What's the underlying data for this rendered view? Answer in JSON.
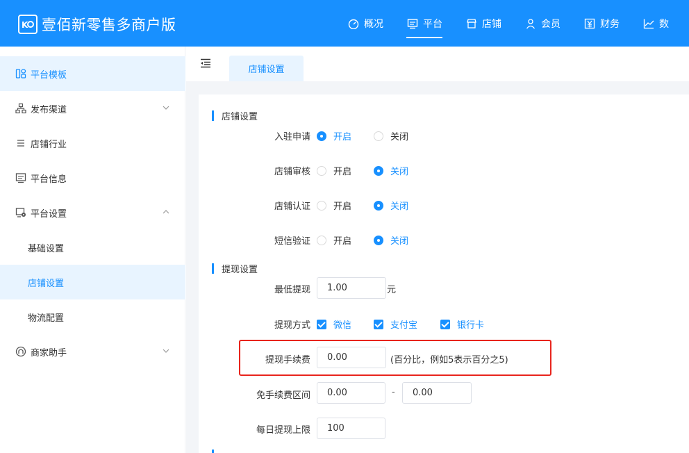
{
  "header": {
    "title": "壹佰新零售多商户版",
    "nav": [
      {
        "label": "概况",
        "icon": "dashboard-icon"
      },
      {
        "label": "平台",
        "icon": "monitor-icon"
      },
      {
        "label": "店铺",
        "icon": "shop-icon"
      },
      {
        "label": "会员",
        "icon": "user-icon"
      },
      {
        "label": "财务",
        "icon": "finance-icon"
      },
      {
        "label": "数",
        "icon": "chart-line-icon"
      }
    ]
  },
  "sidebar": {
    "items": [
      {
        "label": "平台模板"
      },
      {
        "label": "发布渠道"
      },
      {
        "label": "店铺行业"
      },
      {
        "label": "平台信息"
      },
      {
        "label": "平台设置"
      },
      {
        "label": "基础设置"
      },
      {
        "label": "店铺设置"
      },
      {
        "label": "物流配置"
      },
      {
        "label": "商家助手"
      }
    ]
  },
  "tab": {
    "label": "店铺设置"
  },
  "store_settings": {
    "title": "店铺设置",
    "rows": [
      {
        "label": "入驻申请",
        "on": "开启",
        "off": "关闭"
      },
      {
        "label": "店铺审核",
        "on": "开启",
        "off": "关闭"
      },
      {
        "label": "店铺认证",
        "on": "开启",
        "off": "关闭"
      },
      {
        "label": "短信验证",
        "on": "开启",
        "off": "关闭"
      }
    ]
  },
  "withdraw_settings": {
    "title": "提现设置",
    "min_label": "最低提现",
    "min_value": "1.00",
    "min_unit": "元",
    "method_label": "提现方式",
    "methods": [
      "微信",
      "支付宝",
      "银行卡"
    ],
    "fee_label": "提现手续费",
    "fee_value": "0.00",
    "fee_hint": "(百分比，例如5表示百分之5)",
    "free_label": "免手续费区间",
    "free_from": "0.00",
    "free_sep": "-",
    "free_to": "0.00",
    "daily_label": "每日提现上限",
    "daily_value": "100"
  }
}
